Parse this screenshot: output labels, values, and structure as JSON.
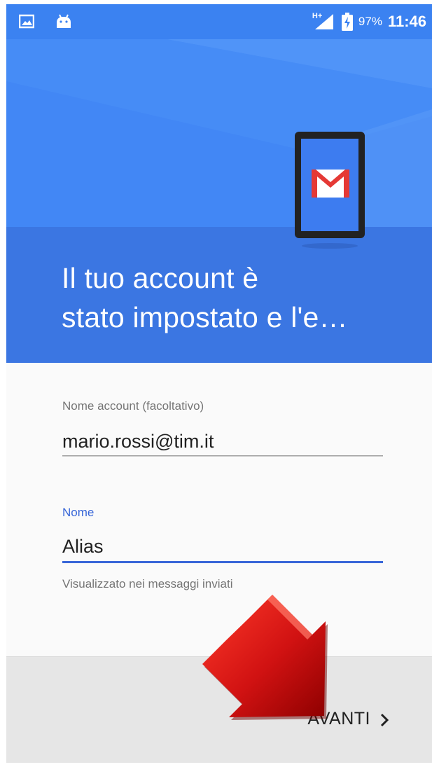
{
  "status_bar": {
    "left_icons": [
      "image-notification-icon",
      "android-notification-icon"
    ],
    "network_label": "H+",
    "battery_percent": "97%",
    "time": "11:46"
  },
  "header": {
    "title_line1": "Il tuo account è",
    "title_line2": "stato impostato e l'e…",
    "illustration": "gmail-phone-illustration"
  },
  "form": {
    "account_name": {
      "label": "Nome account (facoltativo)",
      "value": "mario.rossi@tim.it"
    },
    "name": {
      "label": "Nome",
      "value": "Alias",
      "helper": "Visualizzato nei messaggi inviati"
    }
  },
  "footer": {
    "next_label": "AVANTI",
    "next_icon": "chevron-right-icon"
  },
  "annotation": {
    "type": "red-arrow-pointing-to-next"
  },
  "colors": {
    "header_blue": "#3b76e2",
    "status_blue": "#3b82f1",
    "focus_blue": "#3866d8",
    "arrow_red": "#d11212"
  }
}
